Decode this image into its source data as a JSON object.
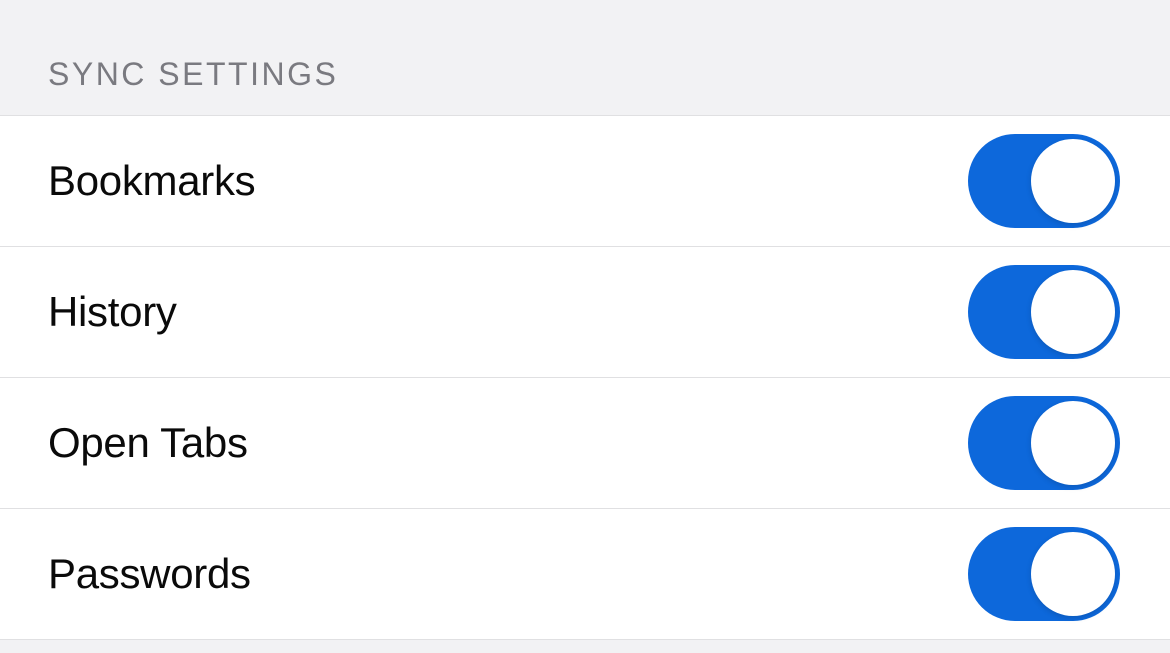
{
  "section": {
    "header": "SYNC SETTINGS",
    "items": [
      {
        "label": "Bookmarks",
        "enabled": true
      },
      {
        "label": "History",
        "enabled": true
      },
      {
        "label": "Open Tabs",
        "enabled": true
      },
      {
        "label": "Passwords",
        "enabled": true
      }
    ]
  }
}
